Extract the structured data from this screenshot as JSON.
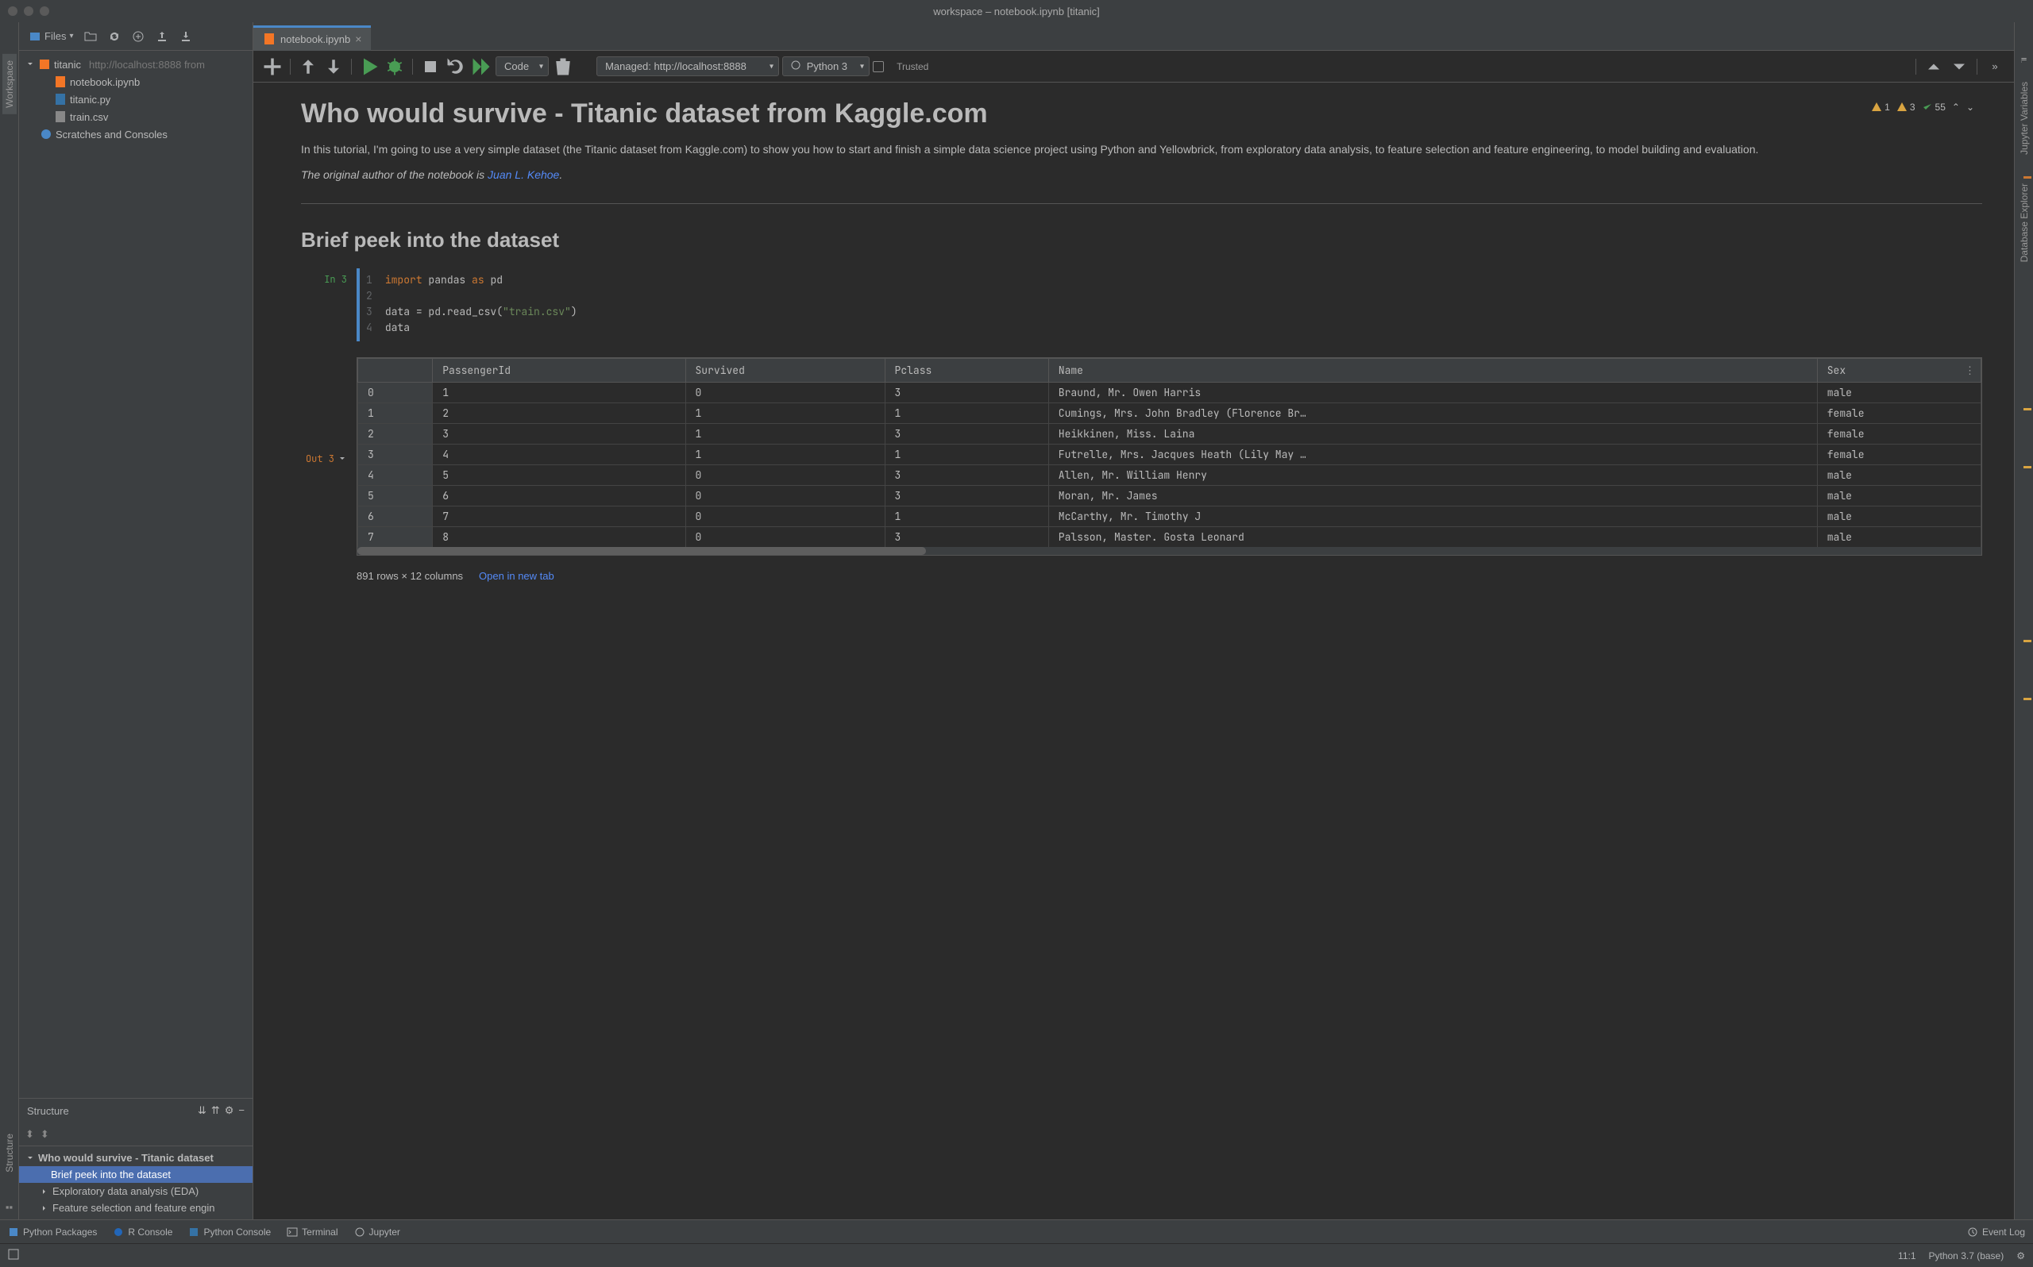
{
  "window": {
    "title": "workspace – notebook.ipynb [titanic]"
  },
  "leftRail": {
    "workspace": "Workspace",
    "structure": "Structure"
  },
  "rightRail": {
    "jupyterVars": "Jupyter Variables",
    "dbExplorer": "Database Explorer"
  },
  "projectToolbar": {
    "filesLabel": "Files"
  },
  "projectTree": {
    "root": {
      "name": "titanic",
      "detail": "http://localhost:8888 from"
    },
    "children": [
      {
        "name": "notebook.ipynb",
        "type": "ipynb"
      },
      {
        "name": "titanic.py",
        "type": "py"
      },
      {
        "name": "train.csv",
        "type": "csv"
      }
    ],
    "scratches": "Scratches and Consoles"
  },
  "structurePanel": {
    "title": "Structure",
    "items": [
      {
        "label": "Who would survive - Titanic dataset",
        "indent": 0,
        "expanded": true
      },
      {
        "label": "Brief peek into the dataset",
        "indent": 1,
        "selected": true
      },
      {
        "label": "Exploratory data analysis (EDA)",
        "indent": 1,
        "hasChildren": true
      },
      {
        "label": "Feature selection and feature engin",
        "indent": 1,
        "hasChildren": true
      }
    ]
  },
  "editor": {
    "tab": {
      "name": "notebook.ipynb"
    },
    "toolbar": {
      "cellType": "Code",
      "managed": "Managed: http://localhost:8888",
      "kernel": "Python 3",
      "trusted": "Trusted"
    },
    "headerBadges": {
      "warn1": "1",
      "warn2": "3",
      "checks": "55"
    }
  },
  "markdown": {
    "h1": "Who would survive - Titanic dataset from Kaggle.com",
    "p1": "In this tutorial, I'm going to use a very simple dataset (the Titanic dataset from Kaggle.com) to show you how to start and finish a simple data science project using Python and Yellowbrick, from exploratory data analysis, to feature selection and feature engineering, to model building and evaluation.",
    "p2_prefix": "The original author of the notebook is ",
    "p2_link": "Juan L. Kehoe",
    "p2_suffix": ".",
    "h2": "Brief peek into the dataset"
  },
  "code": {
    "inLabel": "In 3",
    "outLabel": "Out 3",
    "lines": [
      {
        "tokens": [
          {
            "t": "import",
            "c": "kw"
          },
          {
            "t": " pandas ",
            "c": "id"
          },
          {
            "t": "as",
            "c": "kw"
          },
          {
            "t": " pd",
            "c": "id"
          }
        ]
      },
      {
        "tokens": []
      },
      {
        "tokens": [
          {
            "t": "data = pd.read_csv(",
            "c": "id"
          },
          {
            "t": "\"train.csv\"",
            "c": "str"
          },
          {
            "t": ")",
            "c": "id"
          }
        ]
      },
      {
        "tokens": [
          {
            "t": "data",
            "c": "id"
          }
        ]
      }
    ]
  },
  "table": {
    "headers": [
      "",
      "PassengerId",
      "Survived",
      "Pclass",
      "Name",
      "Sex"
    ],
    "rows": [
      [
        "0",
        "1",
        "0",
        "3",
        "Braund, Mr. Owen Harris",
        "male"
      ],
      [
        "1",
        "2",
        "1",
        "1",
        "Cumings, Mrs. John Bradley (Florence Br…",
        "female"
      ],
      [
        "2",
        "3",
        "1",
        "3",
        "Heikkinen, Miss. Laina",
        "female"
      ],
      [
        "3",
        "4",
        "1",
        "1",
        "Futrelle, Mrs. Jacques Heath (Lily May …",
        "female"
      ],
      [
        "4",
        "5",
        "0",
        "3",
        "Allen, Mr. William Henry",
        "male"
      ],
      [
        "5",
        "6",
        "0",
        "3",
        "Moran, Mr. James",
        "male"
      ],
      [
        "6",
        "7",
        "0",
        "1",
        "McCarthy, Mr. Timothy J",
        "male"
      ],
      [
        "7",
        "8",
        "0",
        "3",
        "Palsson, Master. Gosta Leonard",
        "male"
      ]
    ],
    "footer": "891 rows × 12 columns",
    "openLink": "Open in new tab"
  },
  "bottomBar": {
    "pythonPackages": "Python Packages",
    "rConsole": "R Console",
    "pythonConsole": "Python Console",
    "terminal": "Terminal",
    "jupyter": "Jupyter",
    "eventLog": "Event Log"
  },
  "statusBar": {
    "pos": "11:1",
    "interpreter": "Python 3.7 (base)"
  }
}
